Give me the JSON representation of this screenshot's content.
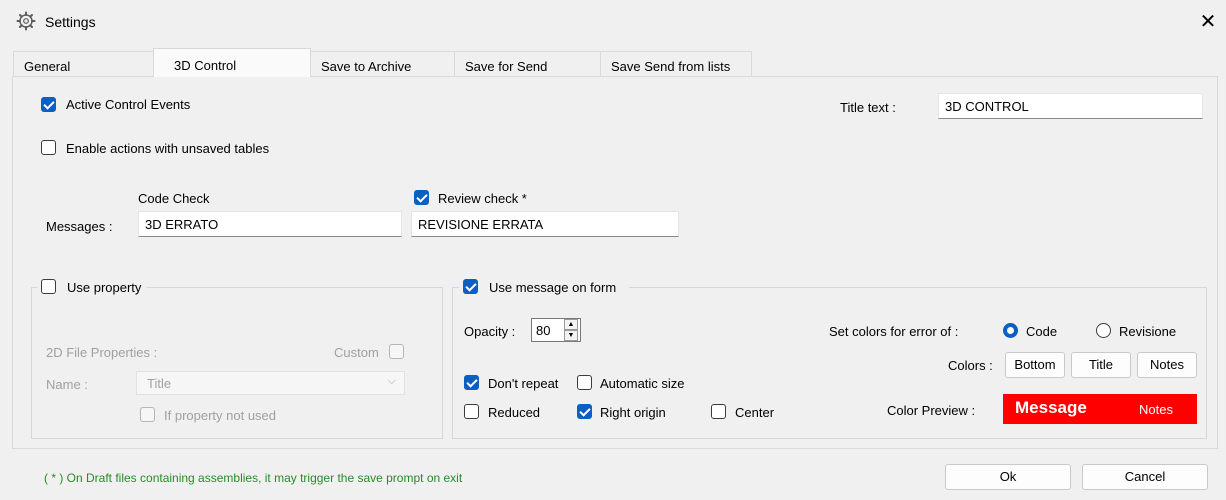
{
  "window": {
    "title": "Settings",
    "icon": "gear-icon"
  },
  "tabs": [
    {
      "label": "General"
    },
    {
      "label": "3D Control"
    },
    {
      "label": "Save to Archive"
    },
    {
      "label": "Save for Send"
    },
    {
      "label": "Save Send from lists"
    }
  ],
  "active_tab": "3D Control",
  "control": {
    "active_events_label": "Active Control Events",
    "active_events_checked": true,
    "unsaved_tables_label": "Enable actions with unsaved tables",
    "unsaved_tables_checked": false,
    "title_text_label": "Title text :",
    "title_text_value": "3D CONTROL"
  },
  "messages": {
    "label": "Messages :",
    "code_check_label": "Code Check",
    "code_check_value": "3D ERRATO",
    "review_check_label": "Review check *",
    "review_check_checked": true,
    "review_check_value": "REVISIONE ERRATA"
  },
  "use_property": {
    "label": "Use property",
    "checked": false,
    "file_properties_label": "2D File Properties :",
    "custom_label": "Custom",
    "name_label": "Name :",
    "name_value": "Title",
    "not_used_label": "If property not used"
  },
  "message_form": {
    "label": "Use message on form",
    "checked": true,
    "opacity_label": "Opacity :",
    "opacity_value": "80",
    "dont_repeat_label": "Don't repeat",
    "dont_repeat_checked": true,
    "automatic_size_label": "Automatic size",
    "automatic_size_checked": false,
    "reduced_label": "Reduced",
    "reduced_checked": false,
    "right_origin_label": "Right origin",
    "right_origin_checked": true,
    "center_label": "Center",
    "center_checked": false,
    "set_colors_label": "Set colors for error of :",
    "radio_code_label": "Code",
    "radio_revisione_label": "Revisione",
    "selected_radio": "Code",
    "colors_label": "Colors :",
    "bottom_button": "Bottom",
    "title_button": "Title",
    "notes_button": "Notes",
    "preview_label": "Color Preview :",
    "preview_message": "Message",
    "preview_notes": "Notes",
    "preview_color": "#ff0000"
  },
  "footer": {
    "note": "( * ) On Draft files containing assemblies, it may trigger the save prompt on exit",
    "ok_button": "Ok",
    "cancel_button": "Cancel"
  }
}
